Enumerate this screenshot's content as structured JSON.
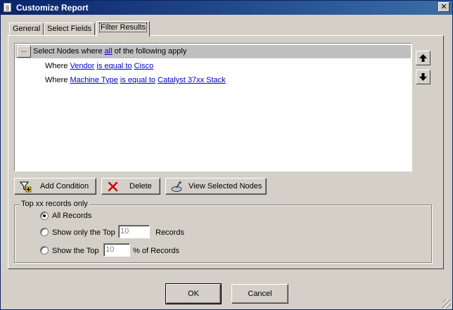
{
  "window": {
    "title": "Customize Report",
    "close_label": "✕"
  },
  "tabs": [
    {
      "label": "General"
    },
    {
      "label": "Select Fields"
    },
    {
      "label": "Filter Results"
    }
  ],
  "filter": {
    "ellipsis_label": "...",
    "header_prefix": "Select Nodes where",
    "header_quantifier": "all",
    "header_suffix": "of the following apply",
    "conditions": [
      {
        "where": "Where",
        "field": "Vendor",
        "operator": "is equal to",
        "value": "Cisco"
      },
      {
        "where": "Where",
        "field": "Machine Type",
        "operator": "is equal to",
        "value": "Catalyst 37xx Stack"
      }
    ],
    "move_up_label": "🡅",
    "move_down_label": "🡇"
  },
  "actions": {
    "add_condition": "Add Condition",
    "delete": "Delete",
    "view_selected_nodes": "View Selected Nodes"
  },
  "top_records": {
    "title": "Top xx records only",
    "all_records": "All Records",
    "show_only_top": "Show only the Top",
    "show_only_top_value": "10",
    "records_label": "Records",
    "show_top": "Show the Top",
    "show_top_value": "10",
    "percent_label": "% of Records",
    "selected": "all_records"
  },
  "footer": {
    "ok": "OK",
    "cancel": "Cancel"
  },
  "colors": {
    "titlebar": "#0a246a",
    "link": "#0000cc",
    "delete_icon": "#cc0000",
    "face": "#d4d0c8"
  }
}
